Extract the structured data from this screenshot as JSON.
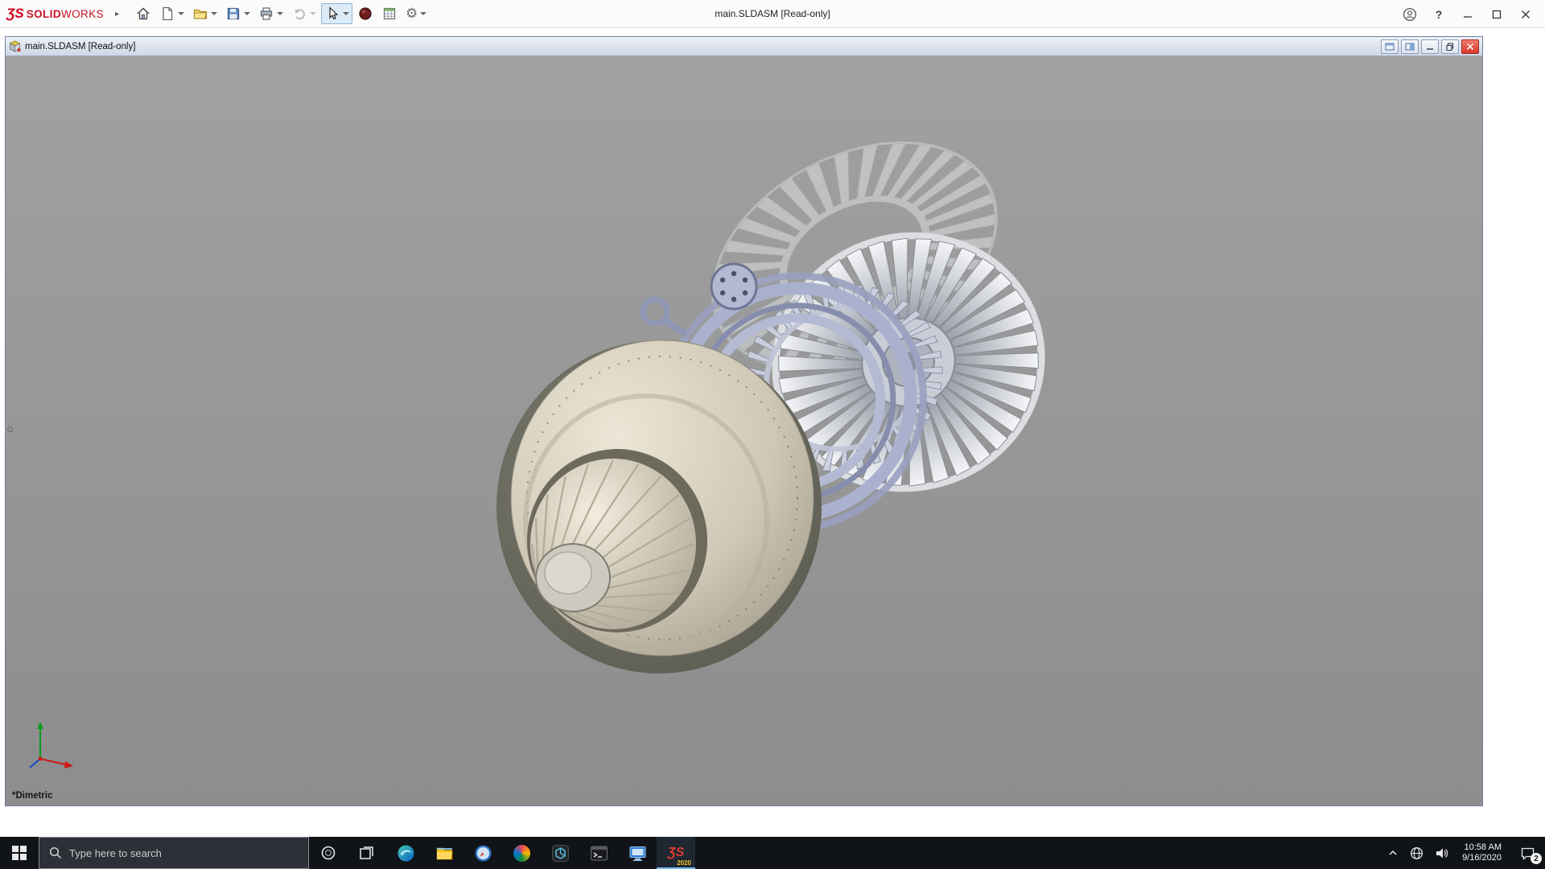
{
  "app": {
    "brand": {
      "mark": "ƷS",
      "name_bold": "SOLID",
      "name_light": "WORKS"
    },
    "window_title": "main.SLDASM [Read-only]",
    "glyphs": {
      "help": "?",
      "gear": "⚙",
      "caret": "",
      "expand_arrow": "▸"
    }
  },
  "document_window": {
    "title": "main.SLDASM [Read-only]",
    "view_orientation_label": "*Dimetric",
    "content_description": "3D CAD assembly of a jet engine turbine"
  },
  "taskbar": {
    "search_placeholder": "Type here to search",
    "solidworks_badge_year": "2020",
    "clock": {
      "time": "10:58 AM",
      "date": "9/16/2020"
    },
    "notification_badge": "2"
  },
  "icons": {
    "titlebar": [
      "solidworks-logo",
      "expand-arrow",
      "home-icon",
      "new-document-icon",
      "open-icon",
      "save-icon",
      "print-icon",
      "undo-icon",
      "select-cursor-icon",
      "sphere-icon",
      "report-icon",
      "settings-gear-icon",
      "account-icon",
      "help-icon",
      "minimize-icon",
      "maximize-icon",
      "close-icon"
    ],
    "doc_window": [
      "assembly-cube-icon",
      "pane-icon",
      "pane-icon",
      "doc-minimize-icon",
      "doc-restore-icon",
      "doc-close-icon"
    ],
    "taskbar": [
      "start-icon",
      "search-icon",
      "cortana-icon",
      "task-view-icon",
      "edge-icon",
      "file-explorer-icon",
      "browser-compass-icon",
      "photos-icon",
      "dark-cube-app-icon",
      "terminal-app-icon",
      "display-app-icon",
      "solidworks-app-icon",
      "tray-chevron-icon",
      "network-icon",
      "volume-icon",
      "action-center-icon"
    ]
  },
  "colors": {
    "brand_red": "#c41425",
    "doc_close_red": "#d83a2b",
    "taskbar_bg": "#101418",
    "viewport_gray": "#979797",
    "engine_cream": "#d9d2c1",
    "engine_periwinkle": "#a7aecb",
    "active_app_underline": "#76b9ed"
  }
}
